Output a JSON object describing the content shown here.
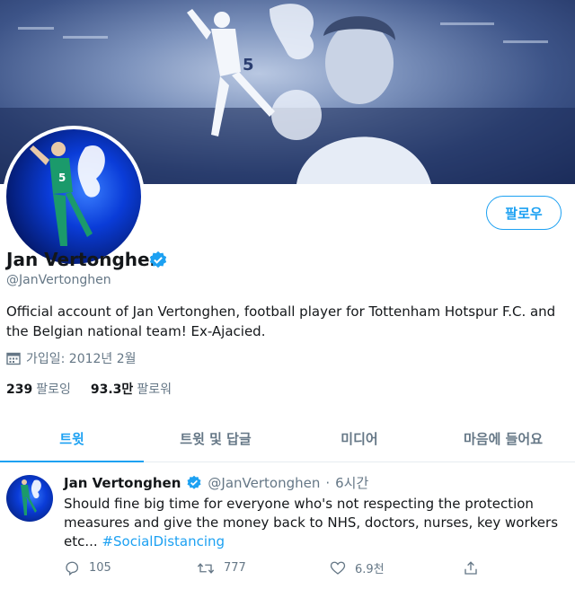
{
  "profile": {
    "name": "Jan Vertonghen",
    "handle": "@JanVertonghen",
    "bio": "Official account of Jan Vertonghen, football player for Tottenham Hotspur F.C. and the Belgian national team! Ex-Ajacied.",
    "joined": "가입일: 2012년 2월",
    "following_count": "239",
    "following_label": "팔로잉",
    "followers_count": "93.3만",
    "followers_label": "팔로워",
    "follow_button": "팔로우"
  },
  "tabs": [
    {
      "label": "트윗",
      "active": true
    },
    {
      "label": "트윗 및 답글",
      "active": false
    },
    {
      "label": "미디어",
      "active": false
    },
    {
      "label": "마음에 들어요",
      "active": false
    }
  ],
  "tweet": {
    "name": "Jan Vertonghen",
    "handle": "@JanVertonghen",
    "separator": "·",
    "time": "6시간",
    "text": "Should fine big time for everyone who's not respecting the protection measures and give the money back to NHS, doctors, nurses, key workers etc... ",
    "hashtag": "#SocialDistancing",
    "replies": "105",
    "retweets": "777",
    "likes": "6.9천"
  },
  "colors": {
    "accent": "#1da1f2",
    "muted": "#657786",
    "text": "#14171a",
    "banner_dark": "#1e2f5e"
  },
  "icons": [
    "verified-badge-icon",
    "calendar-icon",
    "reply-icon",
    "retweet-icon",
    "like-icon",
    "share-icon"
  ]
}
